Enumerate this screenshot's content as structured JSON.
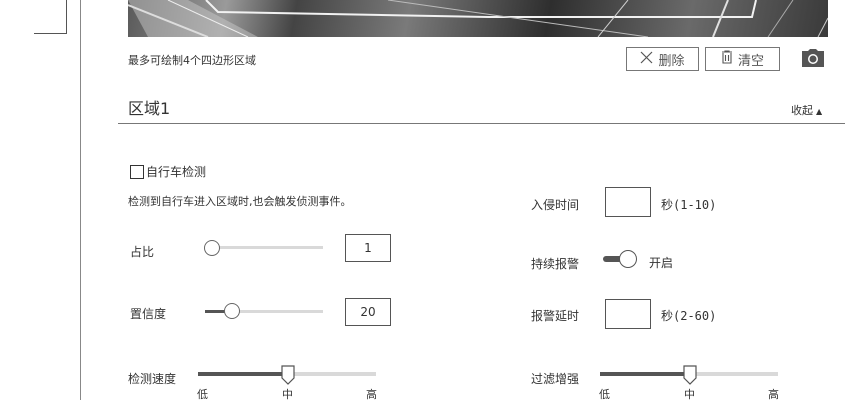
{
  "hint": "最多可绘制4个四边形区域",
  "toolbar": {
    "delete_label": "删除",
    "clear_label": "清空"
  },
  "region": {
    "title": "区域1",
    "collapse_label": "收起"
  },
  "bicycle": {
    "checkbox_label": "自行车检测",
    "checked": false,
    "description": "检测到自行车进入区域时,也会触发侦测事件。"
  },
  "ratio": {
    "label": "占比",
    "value": "1",
    "slider_level": 0.03
  },
  "confidence": {
    "label": "置信度",
    "value": "20",
    "slider_level": 0.2
  },
  "detect_speed": {
    "label": "检测速度",
    "ticks": [
      "低",
      "中",
      "高"
    ],
    "selected": "中"
  },
  "intrusion_time": {
    "label": "入侵时间",
    "value": "",
    "unit": "秒(1-10)"
  },
  "continuous_alarm": {
    "label": "持续报警",
    "state_text": "开启",
    "on": true
  },
  "alarm_delay": {
    "label": "报警延时",
    "value": "",
    "unit": "秒(2-60)"
  },
  "filter_enhance": {
    "label": "过滤增强",
    "ticks": [
      "低",
      "中",
      "高"
    ],
    "selected": "中"
  }
}
